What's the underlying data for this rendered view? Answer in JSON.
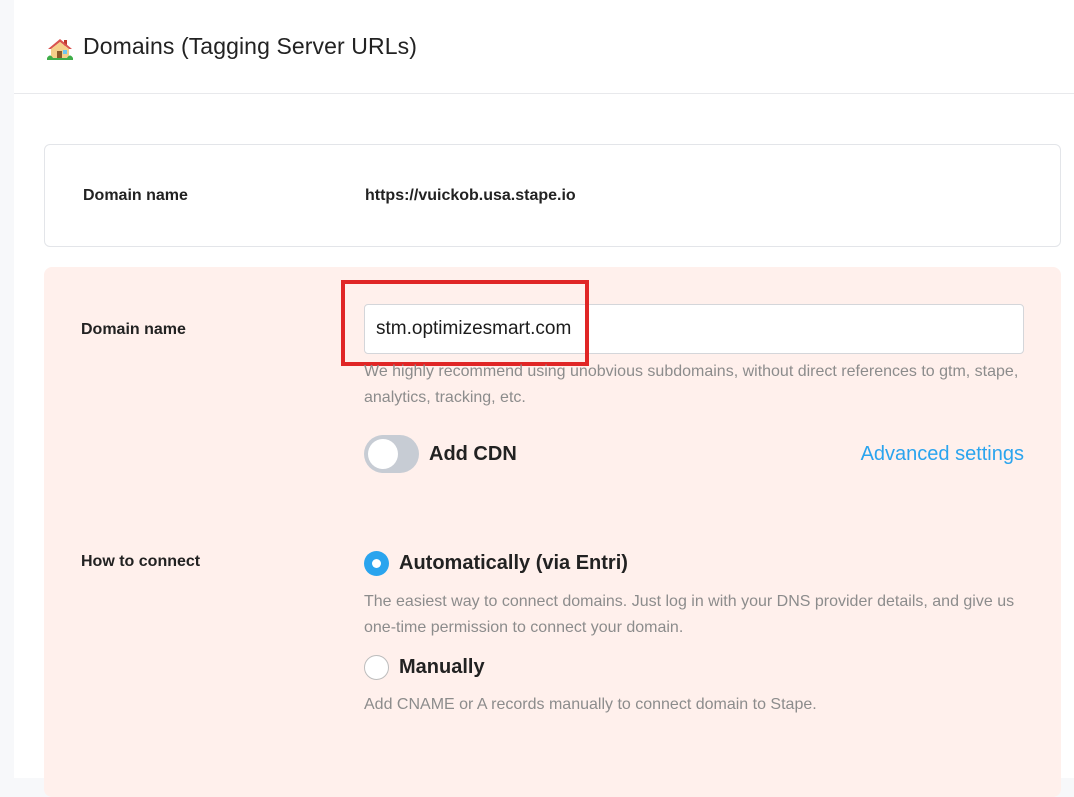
{
  "header": {
    "title": "Domains (Tagging Server URLs)",
    "icon": "house-icon"
  },
  "existing_domain": {
    "label": "Domain name",
    "value": "https://vuickob.usa.stape.io"
  },
  "form": {
    "domain_label": "Domain name",
    "domain_value": "stm.optimizesmart.com",
    "domain_help": "We highly recommend using unobvious subdomains, without direct references to gtm, stape, analytics, tracking, etc.",
    "cdn_toggle_label": "Add CDN",
    "cdn_enabled": false,
    "advanced_settings_label": "Advanced settings",
    "connect_label": "How to connect",
    "options": [
      {
        "label": "Automatically (via Entri)",
        "checked": true,
        "help": "The easiest way to connect domains. Just log in with your DNS provider details, and give us one-time permission to connect your domain."
      },
      {
        "label": "Manually",
        "checked": false,
        "help": "Add CNAME or A records manually to connect domain to Stape."
      }
    ]
  },
  "colors": {
    "accent": "#2aa4ee",
    "form_background": "#fff0ec",
    "highlight": "#e02626"
  }
}
